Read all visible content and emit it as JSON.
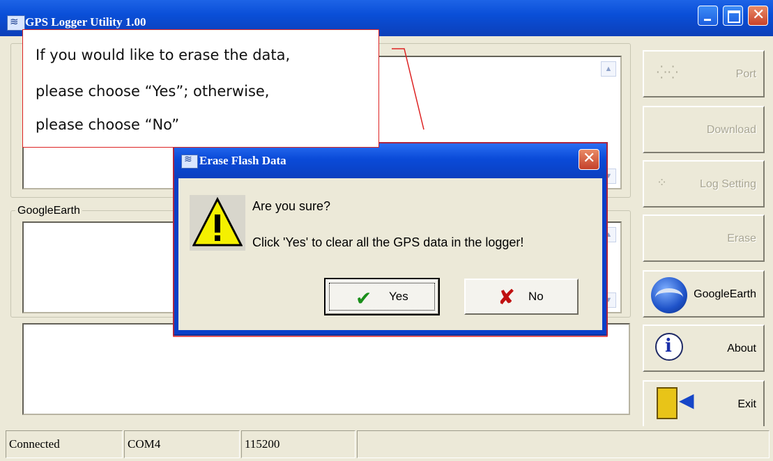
{
  "window": {
    "title": "GPS Logger Utility 1.00"
  },
  "panels": {
    "googleearth_label": "GoogleEarth"
  },
  "sidebar": {
    "buttons": [
      {
        "label": "Port",
        "enabled": false
      },
      {
        "label": "Download",
        "enabled": false
      },
      {
        "label": "Log Setting",
        "enabled": false
      },
      {
        "label": "Erase",
        "enabled": false
      },
      {
        "label": "GoogleEarth",
        "enabled": true
      },
      {
        "label": "About",
        "enabled": true
      },
      {
        "label": "Exit",
        "enabled": true
      }
    ]
  },
  "statusbar": {
    "connection": "Connected",
    "port": "COM4",
    "baud": "115200"
  },
  "dialog": {
    "title": "Erase Flash Data",
    "question": "Are you sure?",
    "message": "Click 'Yes' to clear all the GPS data in the logger!",
    "yes_label": "Yes",
    "no_label": "No"
  },
  "callout": {
    "line1": "If you would like to erase the data,",
    "line2": "please choose “Yes”; otherwise,",
    "line3": "please choose “No”"
  },
  "colors": {
    "titlebar": "#0a4fd8",
    "window_bg": "#ece9d8",
    "callout_border": "#dd2222"
  }
}
